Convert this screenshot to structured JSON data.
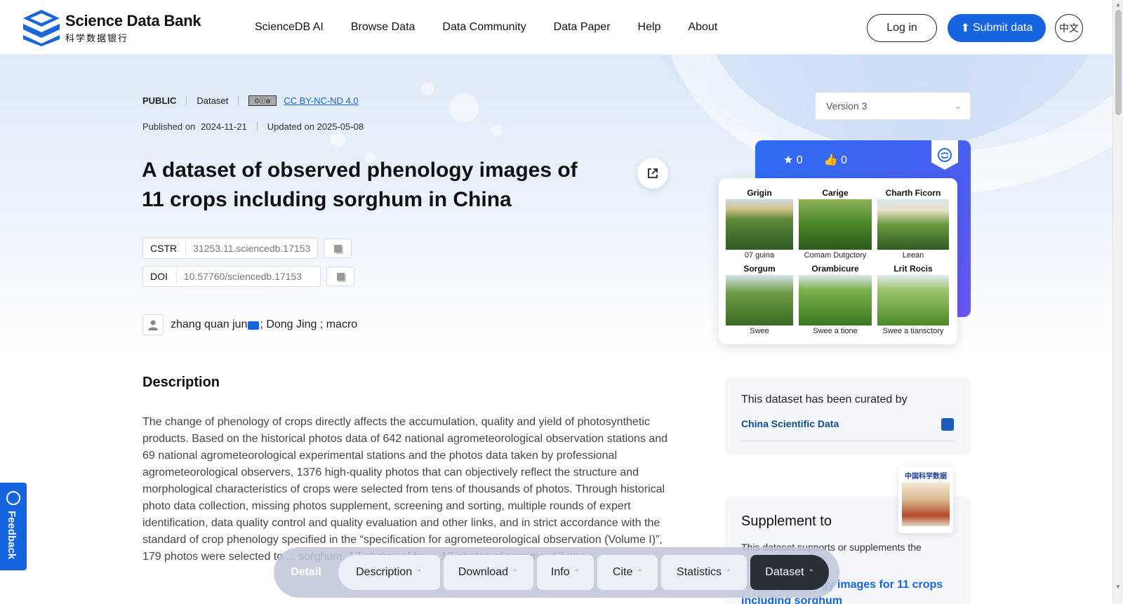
{
  "header": {
    "logo_en": "Science Data Bank",
    "logo_zh": "科学数据银行",
    "nav": [
      "ScienceDB AI",
      "Browse Data",
      "Data Community",
      "Data Paper",
      "Help",
      "About"
    ],
    "login": "Log in",
    "submit": "Submit data",
    "lang": "中文",
    "brand_color": "#1565e0"
  },
  "meta": {
    "access": "PUBLIC",
    "type": "Dataset",
    "license": "CC BY-NC-ND 4.0",
    "published_label": "Published on",
    "published": "2024-11-21",
    "updated": "Updated on 2025-05-08"
  },
  "title": "A dataset of observed phenology images of 11 crops including sorghum in China",
  "identifiers": {
    "cstr_label": "CSTR",
    "cstr": "31253.11.sciencedb.17153",
    "doi_label": "DOI",
    "doi": "10.57760/sciencedb.17153"
  },
  "authors": {
    "first": "zhang quan jun",
    "rest": "; Dong Jing ; macro"
  },
  "description": {
    "heading": "Description",
    "text": "The change of phenology of crops directly affects the accumulation, quality and yield of photosynthetic products. Based on the historical photos data of 642 national agrometeorological observation stations and 69 national agrometeorological experimental stations and the photos data taken by professional agrometeorological observers, 1376 high-quality photos that can objectively reflect the structure and morphological characteristics of crops were selected from tens of thousands of photos. Through historical photo data collection, missing photos supplement, screening and sorting, multiple rounds of expert identification, data quality control and quality evaluation and other links, and in strict accordance with the standard of crop phenology specified in the “specification for agrometeorological observation (Volume I)”, 179 photos were selected to ... sorghum, 17 photos of fox... 13 photos of sesame, 17 phe..."
  },
  "sidebar": {
    "version": "Version 3",
    "stars": "0",
    "likes": "0",
    "crops": [
      {
        "name": "Grigin",
        "caption": "07 guina"
      },
      {
        "name": "Carige",
        "caption": "Comam Dutgctory"
      },
      {
        "name": "Charth Ficorn",
        "caption": "Leean"
      },
      {
        "name": "Sorgum",
        "caption": "Swee"
      },
      {
        "name": "Orambicure",
        "caption": "Swee a tione"
      },
      {
        "name": "Lrit Rocis",
        "caption": "Swee a tiansctory"
      }
    ],
    "curated_label": "This dataset has been curated by",
    "curated_by": "China Scientific Data",
    "supplement_heading": "Supplement to",
    "supplement_text": "This dataset supports or supplements the ... wing papers",
    "supplement_paper": "...rved phenology images for 11 crops including sorghum",
    "cover_title": "中国科学数据"
  },
  "feedback": "Feedback",
  "floatnav": {
    "detail": "Detail",
    "items": [
      "Description",
      "Download",
      "Info",
      "Cite",
      "Statistics",
      "Dataset"
    ]
  }
}
